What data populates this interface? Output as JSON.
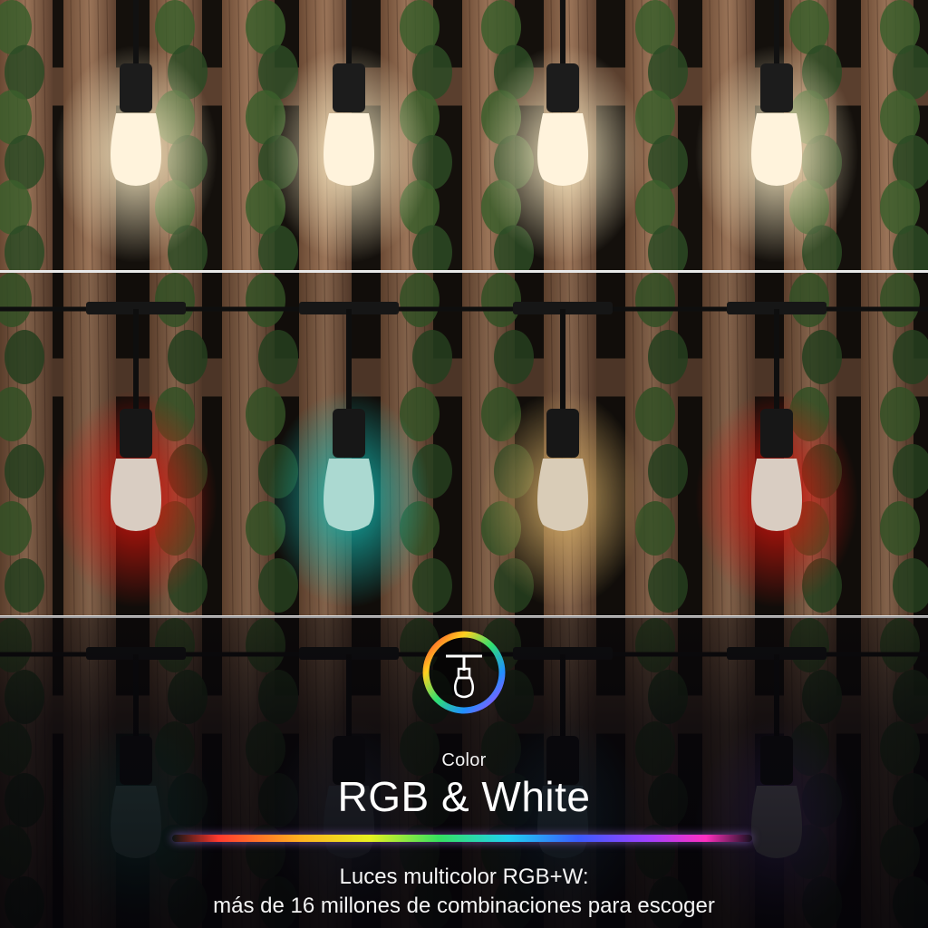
{
  "panels": [
    {
      "name": "white-bulbs-panel",
      "bulb_colors": [
        "#fff3dc",
        "#fff3dc",
        "#fff3dc",
        "#fff3dc"
      ],
      "glow_colors": [
        "#fff0c8",
        "#fff0c8",
        "#fff0c8",
        "#fff0c8"
      ]
    },
    {
      "name": "rgb-bulbs-panel",
      "bulb_colors": [
        "#fff1e4",
        "#c9fff6",
        "#fff0d8",
        "#fff1e4"
      ],
      "glow_colors": [
        "#ff1a10",
        "#19d8d0",
        "#ffcf7a",
        "#ff1a10"
      ]
    },
    {
      "name": "dim-bulbs-panel",
      "bulb_colors": [
        "#7fc7b8",
        "#8a98aa",
        "#7fb6c8",
        "#e6e0f8"
      ],
      "glow_colors": [
        "#2aa890",
        "#6a7a9a",
        "#3a8aa8",
        "#a070ff"
      ]
    }
  ],
  "icon": "color-wheel-bulb-icon",
  "caption": {
    "small": "Color",
    "title": "RGB & White",
    "line1": "Luces multicolor RGB+W:",
    "line2": "más de 16 millones de combinaciones para escoger"
  }
}
